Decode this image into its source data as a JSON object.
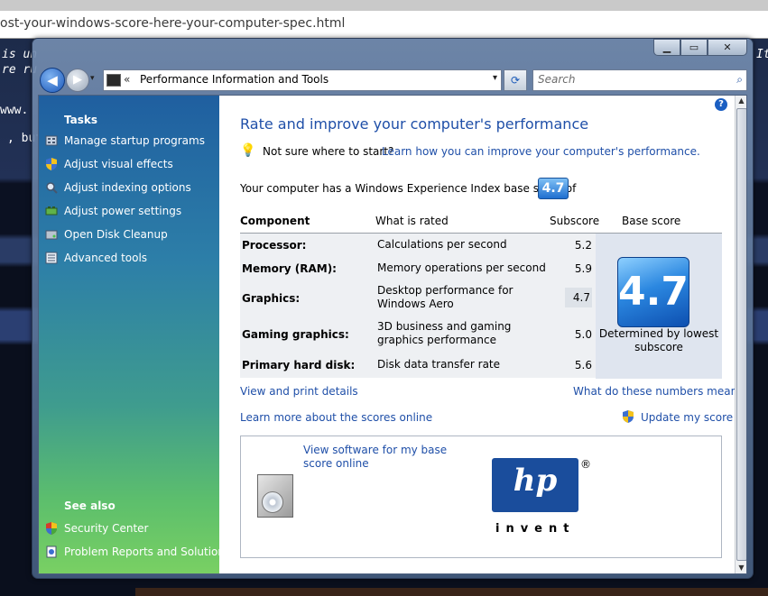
{
  "browser": {
    "url": "ost-your-windows-score-here-your-computer-spec.html",
    "page_fragments": [
      "is un",
      "re ru",
      "www.",
      ", but",
      "It"
    ]
  },
  "window": {
    "controls": {
      "minimize": "▁",
      "maximize": "▭",
      "close": "✕"
    },
    "nav": {
      "back": "◀",
      "forward": "▶",
      "dropdown": "▾"
    },
    "address": {
      "chevron": "«",
      "text": "Performance Information and Tools",
      "dropdown": "▾"
    },
    "refresh": "⟳",
    "search": {
      "placeholder": "Search",
      "icon": "⌕"
    }
  },
  "sidebar": {
    "tasks_heading": "Tasks",
    "tasks": [
      {
        "label": "Manage startup programs",
        "icon": "startup-icon"
      },
      {
        "label": "Adjust visual effects",
        "icon": "shield-icon"
      },
      {
        "label": "Adjust indexing options",
        "icon": "indexing-icon"
      },
      {
        "label": "Adjust power settings",
        "icon": "power-icon"
      },
      {
        "label": "Open Disk Cleanup",
        "icon": "disk-cleanup-icon"
      },
      {
        "label": "Advanced tools",
        "icon": "tools-icon"
      }
    ],
    "see_also_heading": "See also",
    "see_also": [
      {
        "label": "Security Center",
        "icon": "security-center-icon"
      },
      {
        "label": "Problem Reports and Solutions",
        "icon": "problem-reports-icon"
      }
    ]
  },
  "main": {
    "help": "?",
    "title": "Rate and improve your computer's performance",
    "tip": {
      "text": "Not sure where to start?",
      "link": "Learn how you can improve your computer's performance."
    },
    "wei_text": "Your computer has a Windows Experience Index base score of",
    "base_score": "4.7",
    "table": {
      "headers": {
        "component": "Component",
        "what": "What is rated",
        "subscore": "Subscore",
        "base": "Base score"
      },
      "rows": [
        {
          "component": "Processor:",
          "what": "Calculations per second",
          "subscore": "5.2"
        },
        {
          "component": "Memory (RAM):",
          "what": "Memory operations per second",
          "subscore": "5.9"
        },
        {
          "component": "Graphics:",
          "what": "Desktop performance for Windows Aero",
          "subscore": "4.7"
        },
        {
          "component": "Gaming graphics:",
          "what": "3D business and gaming graphics performance",
          "subscore": "5.0"
        },
        {
          "component": "Primary hard disk:",
          "what": "Disk data transfer rate",
          "subscore": "5.6"
        }
      ],
      "base_caption": "Determined by lowest subscore"
    },
    "links": {
      "view_print": "View and print details",
      "what_mean": "What do these numbers mean?",
      "learn_more": "Learn more about the scores online",
      "update": "Update my score"
    },
    "software_box": {
      "link": "View software for my base score online",
      "logo_text": "hp",
      "logo_registered": "®",
      "logo_tagline": "invent"
    }
  },
  "colors": {
    "link": "#1f4fa8",
    "title": "#1f4fa8",
    "sidebar_top": "#1f5fa0",
    "sidebar_bottom": "#79d063",
    "badge": "#1f6fd0"
  }
}
